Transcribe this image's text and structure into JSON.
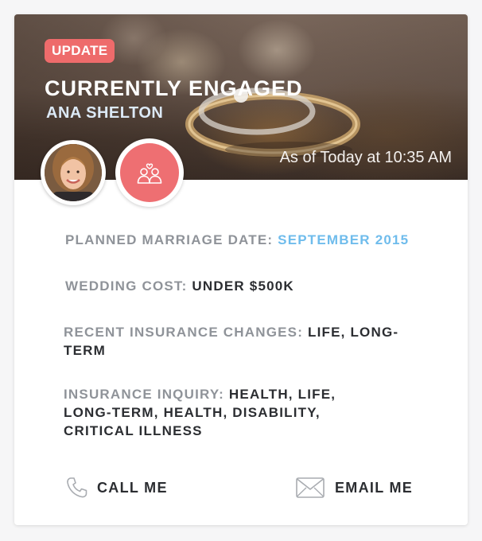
{
  "card": {
    "badge": "UPDATE",
    "title": "CURRENTLY ENGAGED",
    "name": "ANA SHELTON",
    "timestamp": "As of Today at 10:35 AM",
    "status_icon": "couple-heart-icon"
  },
  "details": [
    {
      "label": "PLANNED MARRIAGE DATE: ",
      "value": "SEPTEMBER 2015"
    },
    {
      "label": "WEDDING COST: ",
      "value": "UNDER $500K"
    },
    {
      "label": "RECENT INSURANCE CHANGES: ",
      "value": "LIFE, LONG-TERM"
    },
    {
      "label": "INSURANCE INQUIRY: ",
      "value": "HEALTH, LIFE, LONG-TERM, HEALTH, DISABILITY, CRITICAL ILLNESS"
    }
  ],
  "actions": {
    "call_label": "CALL ME",
    "email_label": "EMAIL ME",
    "call_icon": "phone-icon",
    "email_icon": "envelope-icon"
  },
  "colors": {
    "badge": "#ee6b6b",
    "status": "#ee6f72",
    "highlight_value": "#6fbcec",
    "label": "#8f9399",
    "value": "#2b2d31"
  }
}
